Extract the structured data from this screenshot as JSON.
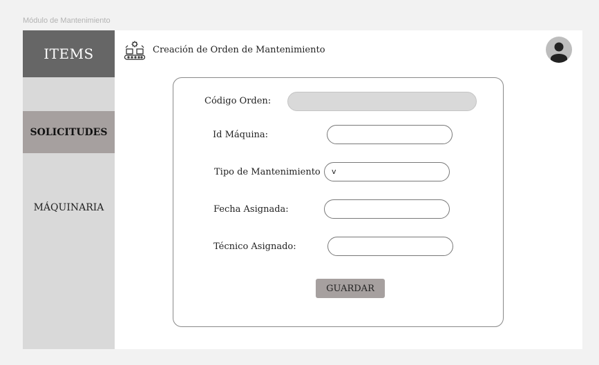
{
  "module_label": "Módulo de Mantenimiento",
  "sidebar": {
    "items": [
      {
        "label": "ITEMS"
      },
      {
        "label": "SOLICITUDES"
      },
      {
        "label": "MÁQUINARIA"
      }
    ]
  },
  "header": {
    "title": "Creación de Orden de Mantenimiento",
    "icon": "maintenance-conveyor-icon",
    "avatar_icon": "user-avatar-icon"
  },
  "form": {
    "fields": [
      {
        "label": "Código Orden:",
        "value": ""
      },
      {
        "label": "Id Máquina:",
        "value": ""
      },
      {
        "label": "Tipo de Mantenimiento",
        "value": "v"
      },
      {
        "label": "Fecha Asignada:",
        "value": ""
      },
      {
        "label": "Técnico Asignado:",
        "value": ""
      }
    ],
    "save_label": "GUARDAR"
  },
  "colors": {
    "sidebar_bg": "#d9d9d9",
    "sidebar_header_bg": "#666666",
    "selected_item_bg": "#a6a09f",
    "button_bg": "#a6a09f",
    "disabled_field_bg": "#d9d9d9"
  }
}
